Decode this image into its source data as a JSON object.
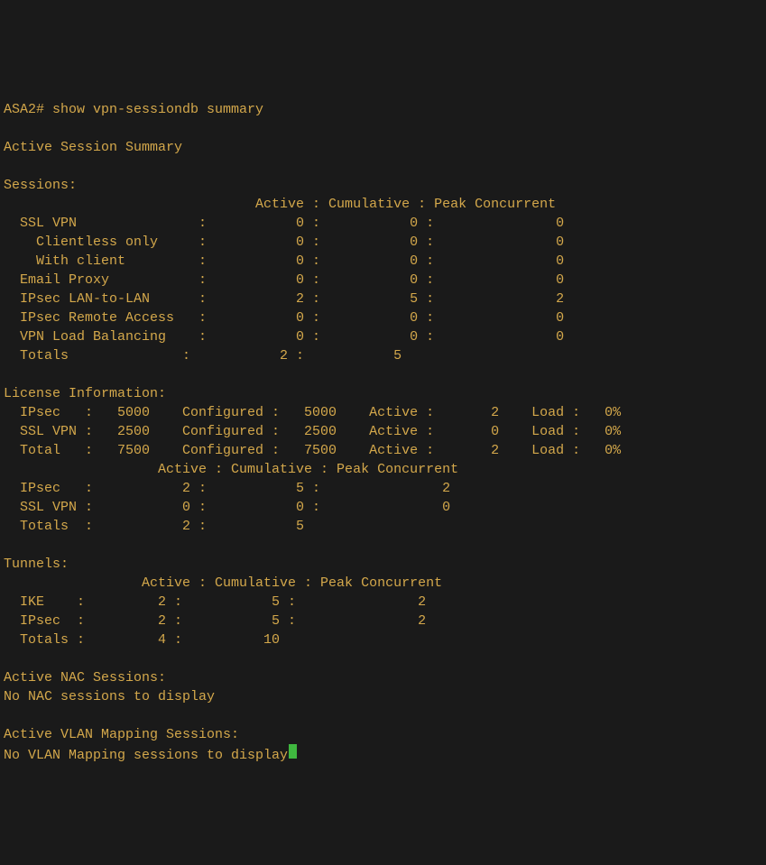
{
  "prompt": "ASA2# ",
  "command": "show vpn-sessiondb summary",
  "summaryTitle": "Active Session Summary",
  "sessions": {
    "heading": "Sessions:",
    "colHeader": "                               Active : Cumulative : Peak Concurrent",
    "rows": [
      {
        "label": "SSL VPN",
        "a": "0",
        "c": "0",
        "p": "0"
      },
      {
        "label": "  Clientless only",
        "a": "0",
        "c": "0",
        "p": "0"
      },
      {
        "label": "  With client",
        "a": "0",
        "c": "0",
        "p": "0"
      },
      {
        "label": "Email Proxy",
        "a": "0",
        "c": "0",
        "p": "0"
      },
      {
        "label": "IPsec LAN-to-LAN",
        "a": "2",
        "c": "5",
        "p": "2"
      },
      {
        "label": "IPsec Remote Access",
        "a": "0",
        "c": "0",
        "p": "0"
      },
      {
        "label": "VPN Load Balancing",
        "a": "0",
        "c": "0",
        "p": "0"
      }
    ],
    "totals": {
      "label": "Totals",
      "a": "2",
      "c": "5"
    }
  },
  "license": {
    "heading": "License Information:",
    "rows": [
      {
        "name": "IPsec",
        "lic": "5000",
        "conf": "5000",
        "active": "2",
        "load": "0%"
      },
      {
        "name": "SSL VPN",
        "lic": "2500",
        "conf": "2500",
        "active": "0",
        "load": "0%"
      },
      {
        "name": "Total",
        "lic": "7500",
        "conf": "7500",
        "active": "2",
        "load": "0%"
      }
    ],
    "subHeader": "                   Active : Cumulative : Peak Concurrent",
    "sub": [
      {
        "name": "IPsec",
        "a": "2",
        "c": "5",
        "p": "2"
      },
      {
        "name": "SSL VPN",
        "a": "0",
        "c": "0",
        "p": "0"
      }
    ],
    "subTotals": {
      "name": "Totals",
      "a": "2",
      "c": "5"
    }
  },
  "tunnels": {
    "heading": "Tunnels:",
    "colHeader": "                 Active : Cumulative : Peak Concurrent",
    "rows": [
      {
        "name": "IKE",
        "a": "2",
        "c": "5",
        "p": "2"
      },
      {
        "name": "IPsec",
        "a": "2",
        "c": "5",
        "p": "2"
      }
    ],
    "totals": {
      "name": "Totals",
      "a": "4",
      "c": "10"
    }
  },
  "nac": {
    "heading": "Active NAC Sessions:",
    "msg": "No NAC sessions to display"
  },
  "vlan": {
    "heading": "Active VLAN Mapping Sessions:",
    "msg": "No VLAN Mapping sessions to display"
  }
}
